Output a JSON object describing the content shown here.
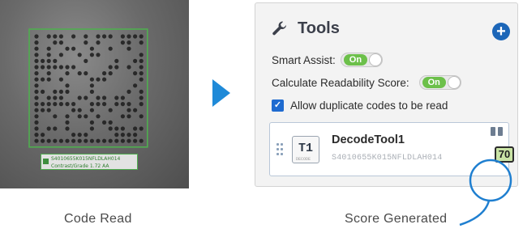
{
  "left_panel": {
    "image_name": "datamatrix-code-image",
    "overlay_line1": "S4010655K015NFLDLAH014",
    "overlay_line2": "Contrast/Grade 1.72 AA",
    "caption": "Code Read"
  },
  "right_panel": {
    "tools_title": "Tools",
    "smart_assist_label": "Smart Assist:",
    "smart_assist_state": "On",
    "calc_score_label": "Calculate Readability Score:",
    "calc_score_state": "On",
    "allow_duplicates_label": "Allow duplicate codes to be read",
    "allow_duplicates_checked": true,
    "tool": {
      "badge": "T1",
      "badge_sub": "DECODE",
      "name": "DecodeTool1",
      "code": "S4010655K015NFLDLAH014",
      "score": "70"
    },
    "caption": "Score Generated"
  },
  "colors": {
    "arrow": "#1f8ad8",
    "toggle_on": "#6cc04a",
    "add_button": "#1c66b8",
    "score_badge": "#c9e3a5",
    "score_circle": "#1f7fd0",
    "read_box": "#4fae4f"
  },
  "icons": [
    "wrench-icon",
    "plus-circle-icon",
    "checkbox-checked-icon",
    "drag-handle-icon",
    "arrow-right-icon"
  ]
}
